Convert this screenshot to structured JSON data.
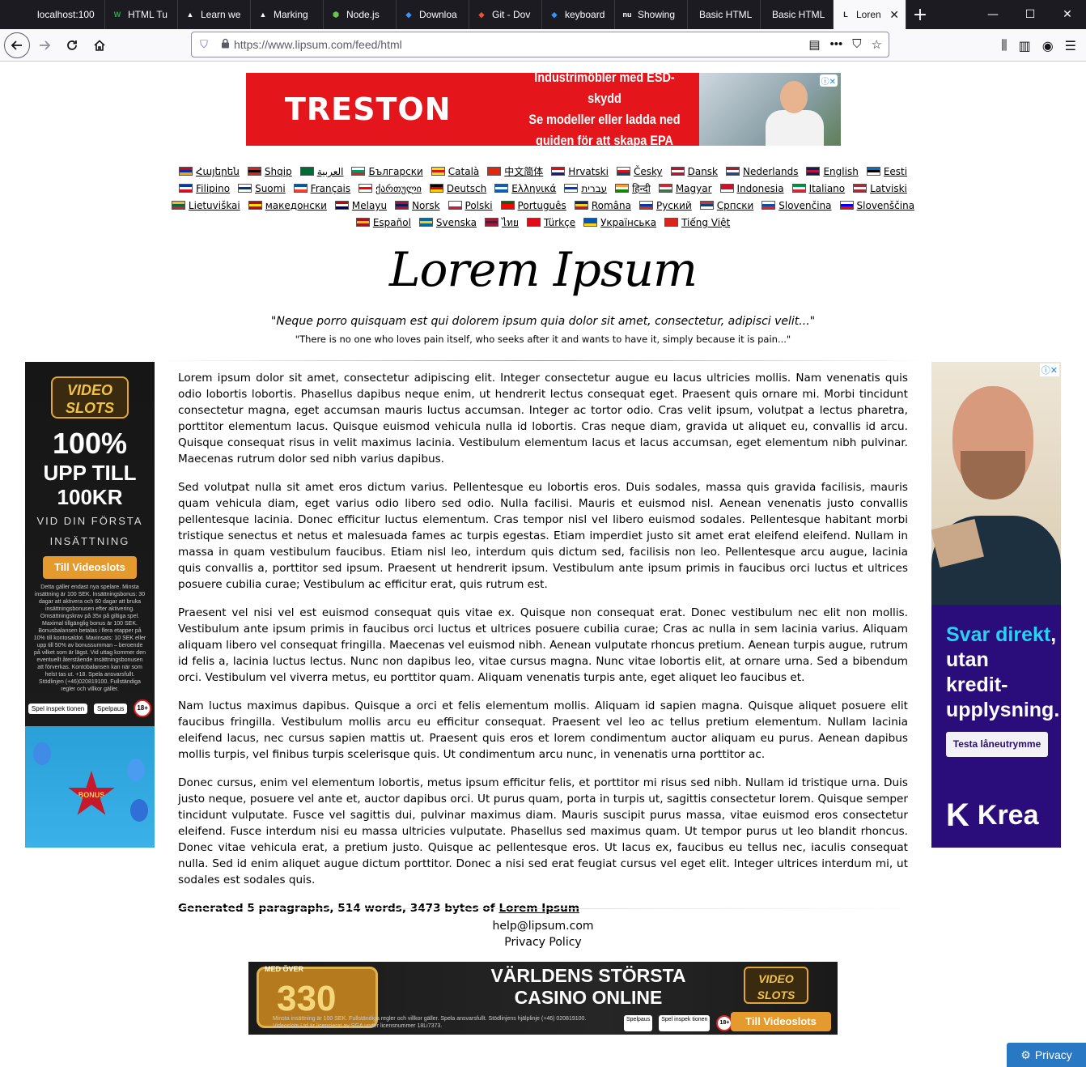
{
  "browser": {
    "tabs": [
      {
        "label": "localhost:100",
        "icon": "",
        "active": false
      },
      {
        "label": "HTML Tu",
        "icon": "W",
        "icon_color": "#2ea44f",
        "active": false
      },
      {
        "label": "Learn we",
        "icon": "▲",
        "icon_color": "#ffffff",
        "active": false
      },
      {
        "label": "Marking",
        "icon": "▲",
        "icon_color": "#ffffff",
        "active": false
      },
      {
        "label": "Node.js",
        "icon": "⬢",
        "icon_color": "#6cc24a",
        "active": false
      },
      {
        "label": "Downloa",
        "icon": "◆",
        "icon_color": "#3794ff",
        "active": false
      },
      {
        "label": "Git - Dov",
        "icon": "◆",
        "icon_color": "#f05033",
        "active": false
      },
      {
        "label": "keyboard",
        "icon": "◆",
        "icon_color": "#3794ff",
        "active": false
      },
      {
        "label": "Showing",
        "icon": "nu",
        "icon_color": "#ffffff",
        "active": false
      },
      {
        "label": "Basic HTML",
        "icon": "",
        "active": false
      },
      {
        "label": "Basic HTML",
        "icon": "",
        "active": false
      },
      {
        "label": "Loren",
        "icon": "L",
        "icon_color": "#15141a",
        "active": true
      }
    ],
    "new_tab": "+",
    "window_controls": {
      "minimize": "—",
      "maximize": "☐",
      "close": "✕"
    },
    "url": "https://www.lipsum.com/feed/html",
    "tab_close": "✕"
  },
  "ads": {
    "top": {
      "brand": "TRESTON",
      "lines": [
        "Industrimöbler med ESD-skydd",
        "Se modeller eller ladda ned",
        "guiden för att skapa EPA"
      ]
    },
    "left": {
      "logo": "VIDEO SLOTS",
      "big": "100%",
      "line2": "UPP TILL",
      "line3": "100KR",
      "sub1": "VID DIN FÖRSTA",
      "sub2": "INSÄTTNING",
      "button": "Till Videoslots",
      "fine": "Detta gäller endast nya spelare. Minsta insättning är 100 SEK. Insättningsbonus: 30 dagar att aktivera och 60 dagar att bruka insättningsbonusen efter aktivering. Omsättningskrav på 35x på giltiga spel. Maximal tillgänglig bonus är 100 SEK. Bonusbalansen betalas i flera etapper på 10% till kontosaldot. Maxinsats: 10 SEK eller upp till 50% av bonussumman – beroende på vilket som är lägst. Vid uttag kommer den eventuellt återstående insättningsbonusen att förverkas. Kontobalansen kan när som helst tas ut. +18. Spela ansvarsfullt. Stödlinjen (+46)020819100. Fullständiga regler och villkor gäller.",
      "badge1": "Spel inspek tionen",
      "badge2": "Spelpaus",
      "badge3": "18+",
      "star": "BONUS"
    },
    "right": {
      "headline_hl": "Svar direkt",
      "headline_rest1": ",",
      "headline_rest2": "utan",
      "headline_rest3": "kredit-",
      "headline_rest4": "upplysning.",
      "cta": "Testa låneutrymme",
      "brand": "Krea",
      "brand_mark": "K"
    },
    "bottom": {
      "slot_text": "330",
      "slot_top": "MED ÖVER",
      "line1": "VÄRLDENS STÖRSTA",
      "line2": "CASINO ONLINE",
      "fine": "Minsta insättning är 100 SEK. Fullständiga regler och villkor gäller. Spela ansvarsfullt. Stödlinjens hjälplinje (+46) 020819100. Videoslots Ltd är licensierat av SGA under licensnummer 18Li7373.",
      "logo": "VIDEO SLOTS",
      "button": "Till Videoslots",
      "badge1": "Spelpaus",
      "badge2": "Spel inspek tionen",
      "badge3": "18+"
    }
  },
  "languages": [
    {
      "name": "Հայերեն",
      "flag": [
        "#d90012",
        "#0033a0",
        "#f2a800"
      ]
    },
    {
      "name": "Shqip",
      "flag": [
        "#e41e20",
        "#000000",
        "#e41e20"
      ]
    },
    {
      "name": "العربية",
      "flag": [
        "#006c35",
        "#006c35",
        "#006c35"
      ]
    },
    {
      "name": "Български",
      "flag": [
        "#ffffff",
        "#00966e",
        "#d62612"
      ]
    },
    {
      "name": "Català",
      "flag": [
        "#fcdd09",
        "#da121a",
        "#fcdd09"
      ]
    },
    {
      "name": "中文简体",
      "flag": [
        "#de2910",
        "#de2910",
        "#de2910"
      ]
    },
    {
      "name": "Hrvatski",
      "flag": [
        "#ff0000",
        "#ffffff",
        "#171796"
      ]
    },
    {
      "name": "Česky",
      "flag": [
        "#ffffff",
        "#d7141a",
        "#11457e"
      ]
    },
    {
      "name": "Dansk",
      "flag": [
        "#c60c30",
        "#ffffff",
        "#c60c30"
      ]
    },
    {
      "name": "Nederlands",
      "flag": [
        "#ae1c28",
        "#ffffff",
        "#21468b"
      ]
    },
    {
      "name": "English",
      "flag": [
        "#012169",
        "#c8102e",
        "#012169"
      ]
    },
    {
      "name": "Eesti",
      "flag": [
        "#0072ce",
        "#000000",
        "#ffffff"
      ]
    },
    {
      "name": "Filipino",
      "flag": [
        "#0038a8",
        "#ffffff",
        "#ce1126"
      ]
    },
    {
      "name": "Suomi",
      "flag": [
        "#ffffff",
        "#003580",
        "#ffffff"
      ]
    },
    {
      "name": "Français",
      "flag": [
        "#0055a4",
        "#ffffff",
        "#ef4135"
      ]
    },
    {
      "name": "ქართული",
      "flag": [
        "#ffffff",
        "#ff0000",
        "#ffffff"
      ]
    },
    {
      "name": "Deutsch",
      "flag": [
        "#000000",
        "#dd0000",
        "#ffce00"
      ]
    },
    {
      "name": "Ελληνικά",
      "flag": [
        "#0d5eaf",
        "#ffffff",
        "#0d5eaf"
      ]
    },
    {
      "name": "עברית",
      "flag": [
        "#ffffff",
        "#0038b8",
        "#ffffff"
      ]
    },
    {
      "name": "हिन्दी",
      "flag": [
        "#ff9933",
        "#ffffff",
        "#138808"
      ]
    },
    {
      "name": "Magyar",
      "flag": [
        "#ce2939",
        "#ffffff",
        "#477050"
      ]
    },
    {
      "name": "Indonesia",
      "flag": [
        "#ce1126",
        "#ce1126",
        "#ffffff"
      ]
    },
    {
      "name": "Italiano",
      "flag": [
        "#009246",
        "#ffffff",
        "#ce2b37"
      ]
    },
    {
      "name": "Latviski",
      "flag": [
        "#9e3039",
        "#ffffff",
        "#9e3039"
      ]
    },
    {
      "name": "Lietuviškai",
      "flag": [
        "#fdb913",
        "#006a44",
        "#c1272d"
      ]
    },
    {
      "name": "македонски",
      "flag": [
        "#d20000",
        "#ffe600",
        "#d20000"
      ]
    },
    {
      "name": "Melayu",
      "flag": [
        "#cc0001",
        "#ffffff",
        "#010066"
      ]
    },
    {
      "name": "Norsk",
      "flag": [
        "#ba0c2f",
        "#00205b",
        "#ba0c2f"
      ]
    },
    {
      "name": "Polski",
      "flag": [
        "#ffffff",
        "#ffffff",
        "#dc143c"
      ]
    },
    {
      "name": "Português",
      "flag": [
        "#006600",
        "#ff0000",
        "#ff0000"
      ]
    },
    {
      "name": "Româna",
      "flag": [
        "#002b7f",
        "#fcd116",
        "#ce1126"
      ]
    },
    {
      "name": "Pycкий",
      "flag": [
        "#ffffff",
        "#0039a6",
        "#d52b1e"
      ]
    },
    {
      "name": "Српски",
      "flag": [
        "#c6363c",
        "#0c4076",
        "#ffffff"
      ]
    },
    {
      "name": "Slovenčina",
      "flag": [
        "#ffffff",
        "#0b4ea2",
        "#ee1c25"
      ]
    },
    {
      "name": "Slovenščina",
      "flag": [
        "#ffffff",
        "#0000ff",
        "#ff0000"
      ]
    },
    {
      "name": "Español",
      "flag": [
        "#aa151b",
        "#f1bf00",
        "#aa151b"
      ]
    },
    {
      "name": "Svenska",
      "flag": [
        "#006aa7",
        "#fecc00",
        "#006aa7"
      ]
    },
    {
      "name": "ไทย",
      "flag": [
        "#a51931",
        "#2d2a4a",
        "#a51931"
      ]
    },
    {
      "name": "Türkçe",
      "flag": [
        "#e30a17",
        "#e30a17",
        "#e30a17"
      ]
    },
    {
      "name": "Українська",
      "flag": [
        "#0057b7",
        "#0057b7",
        "#ffd700"
      ]
    },
    {
      "name": "Tiếng Việt",
      "flag": [
        "#da251d",
        "#da251d",
        "#da251d"
      ]
    }
  ],
  "title": "Lorem Ipsum",
  "quote_latin": "\"Neque porro quisquam est qui dolorem ipsum quia dolor sit amet, consectetur, adipisci velit...\"",
  "quote_english": "\"There is no one who loves pain itself, who seeks after it and wants to have it, simply because it is pain...\"",
  "paragraphs": [
    "Lorem ipsum dolor sit amet, consectetur adipiscing elit. Integer consectetur augue eu lacus ultricies mollis. Nam venenatis quis odio lobortis lobortis. Phasellus dapibus neque enim, ut hendrerit lectus consequat eget. Praesent quis ornare mi. Morbi tincidunt consectetur magna, eget accumsan mauris luctus accumsan. Integer ac tortor odio. Cras velit ipsum, volutpat a lectus pharetra, porttitor elementum lacus. Quisque euismod vehicula nulla id lobortis. Cras neque diam, gravida ut aliquet eu, convallis id arcu. Quisque consequat risus in velit maximus lacinia. Vestibulum elementum lacus et lacus accumsan, eget elementum nibh pulvinar. Maecenas rutrum dolor sed nibh varius dapibus.",
    "Sed volutpat nulla sit amet eros dictum varius. Pellentesque eu lobortis eros. Duis sodales, massa quis gravida facilisis, mauris quam vehicula diam, eget varius odio libero sed odio. Nulla facilisi. Mauris et euismod nisl. Aenean venenatis justo convallis pellentesque lacinia. Donec efficitur luctus elementum. Cras tempor nisl vel libero euismod sodales. Pellentesque habitant morbi tristique senectus et netus et malesuada fames ac turpis egestas. Etiam imperdiet justo sit amet erat eleifend eleifend. Nullam in massa in quam vestibulum faucibus. Etiam nisl leo, interdum quis dictum sed, facilisis non leo. Pellentesque arcu augue, lacinia quis convallis a, porttitor sed ipsum. Praesent ut hendrerit ipsum. Vestibulum ante ipsum primis in faucibus orci luctus et ultrices posuere cubilia curae; Vestibulum ac efficitur erat, quis rutrum est.",
    "Praesent vel nisi vel est euismod consequat quis vitae ex. Quisque non consequat erat. Donec vestibulum nec elit non mollis. Vestibulum ante ipsum primis in faucibus orci luctus et ultrices posuere cubilia curae; Cras ac nulla in sem lacinia varius. Aliquam aliquam libero vel consequat fringilla. Maecenas vel euismod nibh. Aenean vulputate rhoncus pretium. Aenean turpis augue, rutrum id felis a, lacinia luctus lectus. Nunc non dapibus leo, vitae cursus magna. Nunc vitae lobortis elit, at ornare urna. Sed a bibendum orci. Vestibulum vel viverra metus, eu porttitor quam. Aliquam venenatis turpis ante, eget aliquet leo faucibus et.",
    "Nam luctus maximus dapibus. Quisque a orci et felis elementum mollis. Aliquam id sapien magna. Quisque aliquet posuere elit faucibus fringilla. Vestibulum mollis arcu eu efficitur consequat. Praesent vel leo ac tellus pretium elementum. Nullam lacinia eleifend lacus, nec cursus sapien mattis ut. Praesent quis eros et lorem condimentum auctor aliquam eu purus. Aenean dapibus mollis turpis, vel finibus turpis scelerisque quis. Ut condimentum arcu nunc, in venenatis urna porttitor ac.",
    "Donec cursus, enim vel elementum lobortis, metus ipsum efficitur felis, et porttitor mi risus sed nibh. Nullam id tristique urna. Duis justo neque, posuere vel ante et, auctor dapibus orci. Ut purus quam, porta in turpis ut, sagittis consectetur lorem. Quisque semper tincidunt vulputate. Fusce vel sagittis dui, pulvinar maximus diam. Mauris suscipit purus massa, vitae euismod eros consectetur eleifend. Fusce interdum nisi eu massa ultricies vulputate. Phasellus sed maximus quam. Ut tempor purus ut leo blandit rhoncus. Donec vitae vehicula erat, a pretium justo. Quisque ac pellentesque eros. Ut lacus ex, faucibus eu tellus nec, iaculis consequat nulla. Sed id enim aliquet augue dictum porttitor. Donec a nisi sed erat feugiat cursus vel eget elit. Integer ultrices interdum mi, ut sodales est sodales quis."
  ],
  "generated": {
    "prefix": "Generated 5 paragraphs, 514 words, 3473 bytes of ",
    "link": "Lorem Ipsum"
  },
  "footer": {
    "email": "help@lipsum.com",
    "privacy": "Privacy Policy"
  },
  "privacy_button": "Privacy"
}
